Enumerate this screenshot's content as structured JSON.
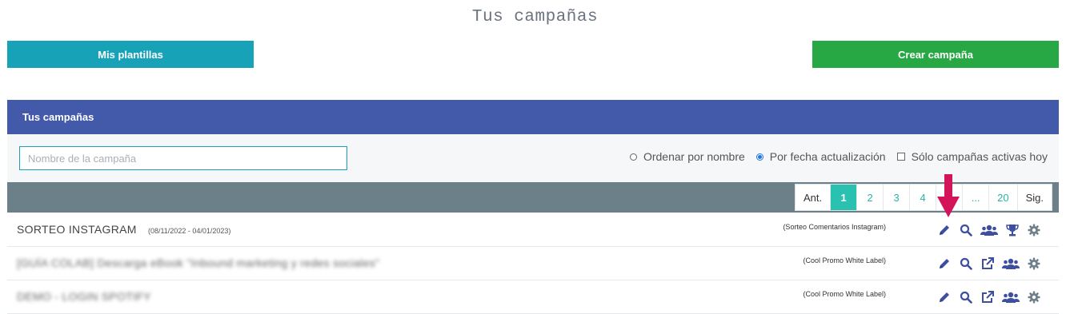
{
  "page_title": "Tus campañas",
  "buttons": {
    "templates": "Mis plantillas",
    "create": "Crear campaña"
  },
  "panel": {
    "title": "Tus campañas"
  },
  "filter": {
    "search_placeholder": "Nombre de la campaña",
    "sort_by_name": "Ordenar por nombre",
    "sort_by_date": "Por fecha actualización",
    "only_active": "Sólo campañas activas hoy",
    "selected_sort": "Por fecha actualización",
    "only_active_checked": false
  },
  "pagination": {
    "prev": "Ant.",
    "pages": [
      "1",
      "2",
      "3",
      "4",
      "5",
      "...",
      "20"
    ],
    "current": "1",
    "next": "Sig."
  },
  "campaigns": [
    {
      "name": "SORTEO INSTAGRAM",
      "dates": "(08/11/2022 - 04/01/2023)",
      "type": "(Sorteo Comentarios Instagram)"
    },
    {
      "name": "[GUÍA COLAB] Descarga eBook \"Inbound marketing y redes sociales\"",
      "dates": "",
      "type": "(Cool Promo White Label)"
    },
    {
      "name": "DEMO - LOGIN SPOTIFY",
      "dates": "",
      "type": "(Cool Promo White Label)"
    }
  ],
  "colors": {
    "header": "#435aab",
    "templates_button": "#17a2b8",
    "create_button": "#28a745",
    "active_page": "#2bc1b0",
    "icon": "#3d4f9f",
    "arrow": "#d4145a"
  },
  "icons": [
    "pencil-icon",
    "search-icon",
    "external-link-icon",
    "users-icon",
    "trophy-icon",
    "gear-icon",
    "down-arrow-icon"
  ]
}
